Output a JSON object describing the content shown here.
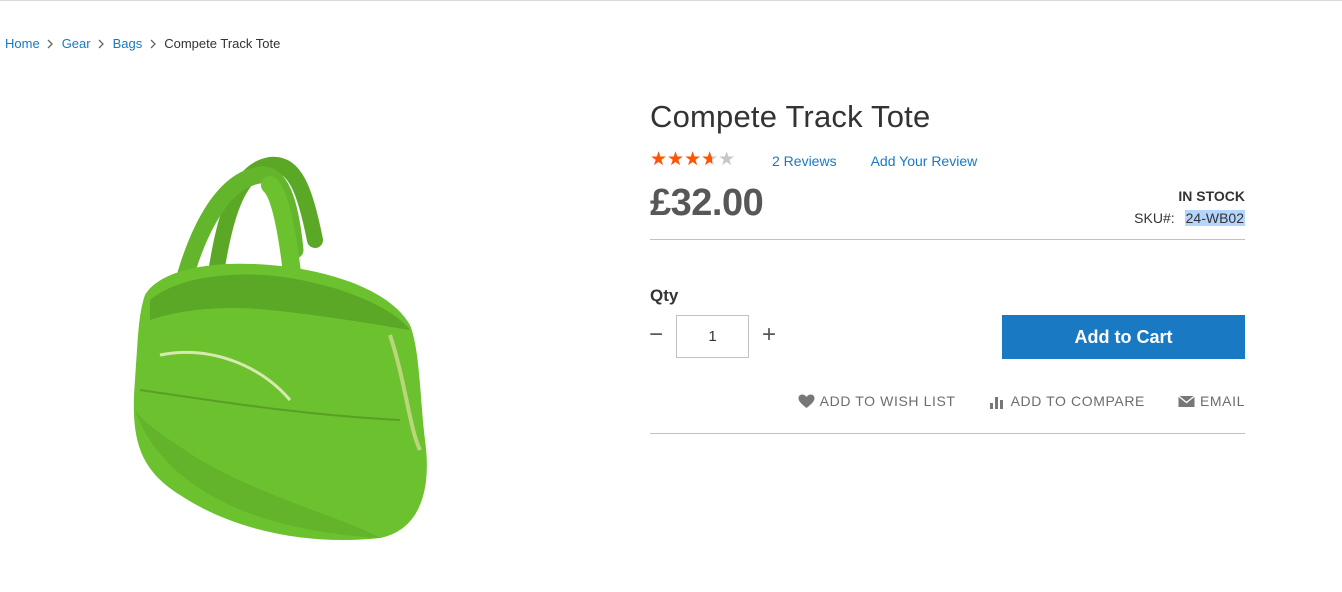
{
  "breadcrumbs": {
    "items": [
      {
        "label": "Home"
      },
      {
        "label": "Gear"
      },
      {
        "label": "Bags"
      }
    ],
    "current": "Compete Track Tote"
  },
  "product": {
    "title": "Compete Track Tote",
    "rating_percent": 70,
    "reviews_link": "2  Reviews",
    "add_review_link": "Add Your Review",
    "price": "£32.00",
    "stock_status": "In stock",
    "sku_label": "SKU#:",
    "sku_value": "24-WB02",
    "image_alt_icon": "green-tote-bag-photo"
  },
  "purchase": {
    "qty_label": "Qty",
    "qty_value": "1",
    "add_to_cart_label": "Add to Cart"
  },
  "actions": {
    "wish_list": "Add to Wish List",
    "compare": "Add to Compare",
    "email": "Email"
  },
  "colors": {
    "link": "#1979c3",
    "star": "#ff5501",
    "button": "#1979c3",
    "product_green": "#6cc12e"
  }
}
